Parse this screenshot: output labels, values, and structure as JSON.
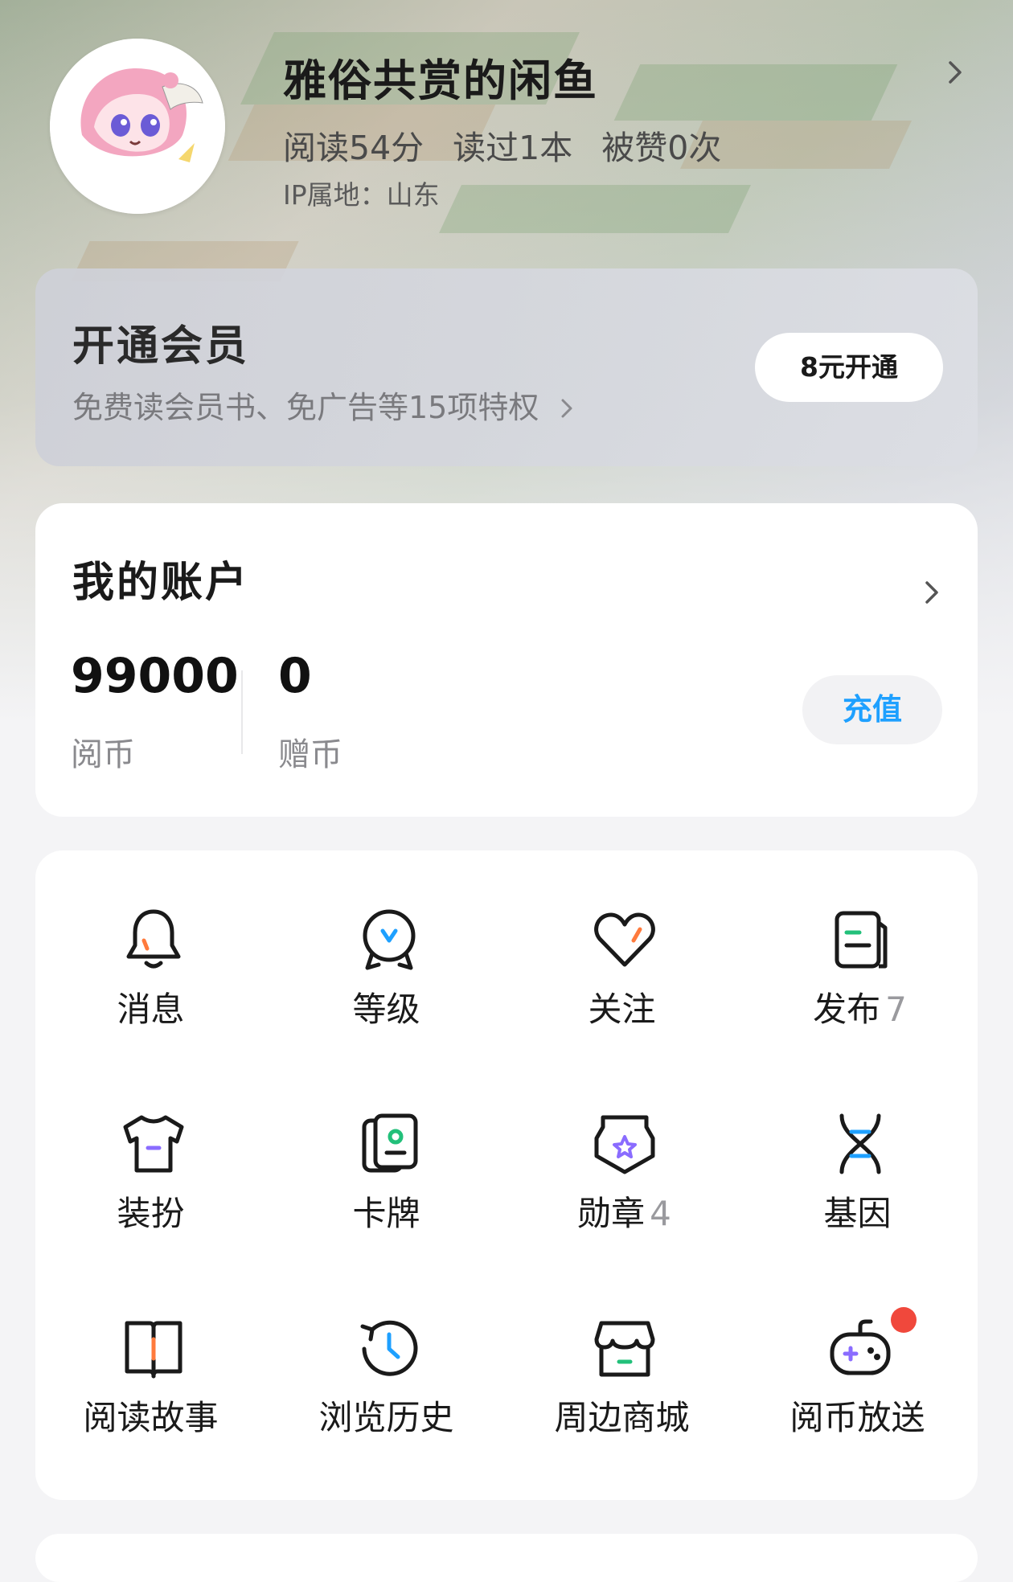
{
  "profile": {
    "username": "雅俗共赏的闲鱼",
    "stats": [
      "阅读54分",
      "读过1本",
      "被赞0次"
    ],
    "ip_location": "IP属地：山东"
  },
  "membership": {
    "title": "开通会员",
    "subtitle": "免费读会员书、免广告等15项特权",
    "button_label": "8元开通"
  },
  "account": {
    "title": "我的账户",
    "coins": {
      "value": "99000",
      "label": "阅币"
    },
    "gift_coins": {
      "value": "0",
      "label": "赠币"
    },
    "recharge_label": "充值"
  },
  "menu": [
    {
      "label": "消息",
      "badge": "",
      "icon": "bell-icon"
    },
    {
      "label": "等级",
      "badge": "",
      "icon": "level-medal-icon"
    },
    {
      "label": "关注",
      "badge": "",
      "icon": "heart-icon"
    },
    {
      "label": "发布",
      "badge": "7",
      "icon": "publish-document-icon"
    },
    {
      "label": "装扮",
      "badge": "",
      "icon": "tshirt-icon"
    },
    {
      "label": "卡牌",
      "badge": "",
      "icon": "cards-icon"
    },
    {
      "label": "勋章",
      "badge": "4",
      "icon": "badge-shield-icon"
    },
    {
      "label": "基因",
      "badge": "",
      "icon": "dna-icon"
    },
    {
      "label": "阅读故事",
      "badge": "",
      "icon": "open-book-icon"
    },
    {
      "label": "浏览历史",
      "badge": "",
      "icon": "history-clock-icon"
    },
    {
      "label": "周边商城",
      "badge": "",
      "icon": "store-icon"
    },
    {
      "label": "阅币放送",
      "badge": "",
      "icon": "gamepad-icon"
    }
  ],
  "colors": {
    "accent_blue": "#1ea0ff",
    "accent_orange": "#ff7a3c",
    "accent_purple": "#8a6cff",
    "accent_green": "#22c07a",
    "notification_red": "#f0483c"
  }
}
